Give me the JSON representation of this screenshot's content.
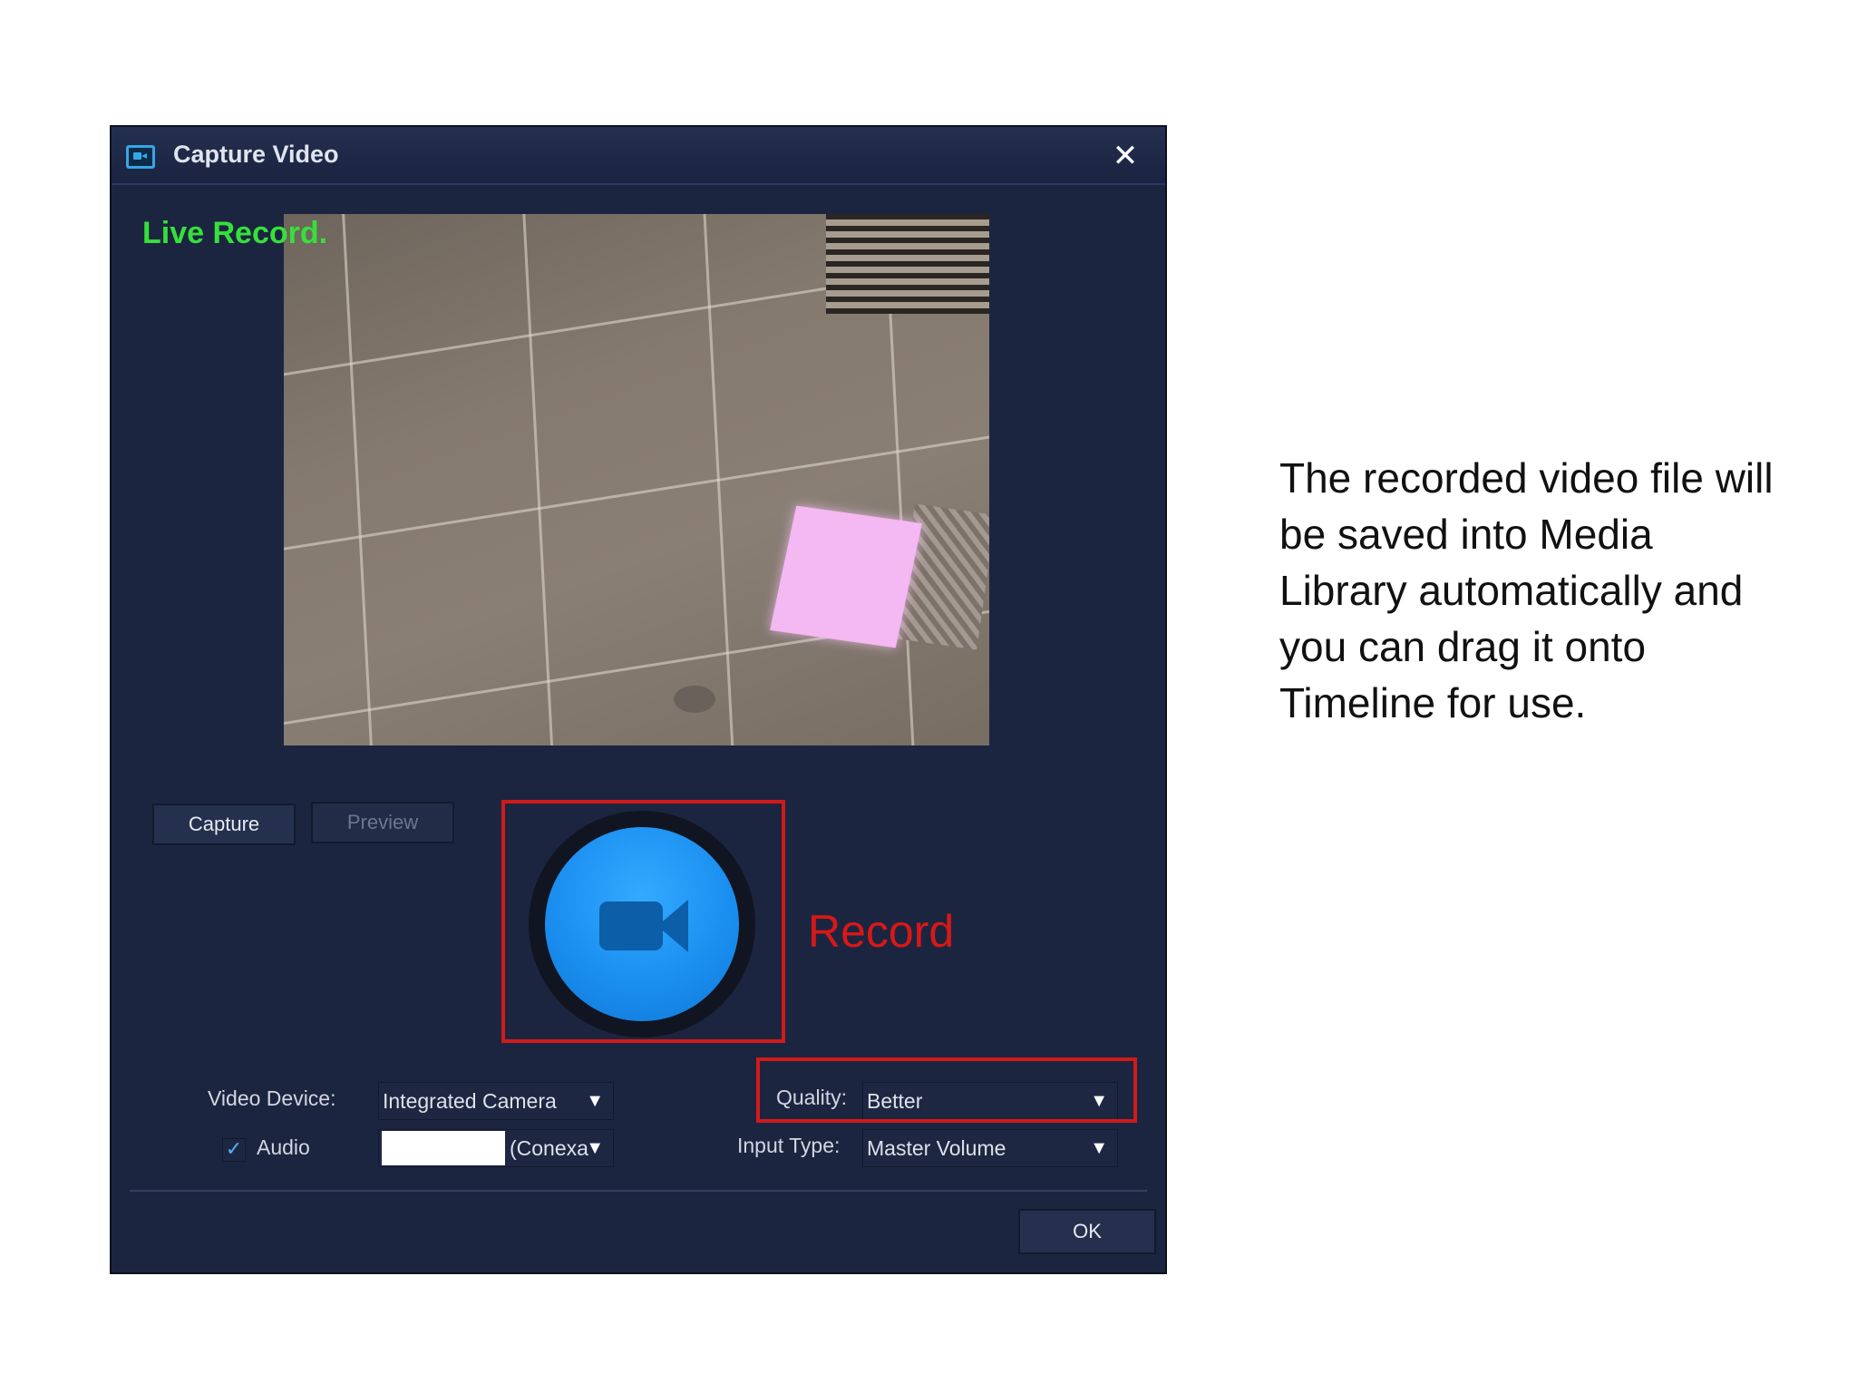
{
  "dialog": {
    "title": "Capture Video",
    "close_symbol": "✕",
    "live_label": "Live Record.",
    "buttons": {
      "capture": "Capture",
      "preview": "Preview",
      "ok": "OK"
    },
    "record_callout": "Record",
    "video_device": {
      "label": "Video Device:",
      "value": "Integrated Camera"
    },
    "quality": {
      "label": "Quality:",
      "value": "Better"
    },
    "audio": {
      "label": "Audio",
      "checked": true,
      "check_symbol": "✓",
      "device_value": "(Conexa"
    },
    "input_type": {
      "label": "Input Type:",
      "value": "Master Volume"
    },
    "dropdown_arrow": "▼"
  },
  "caption": {
    "text": "The recorded video file will be saved into Media Library automatically and you can drag it onto Timeline for use."
  },
  "colors": {
    "window_bg": "#1c2540",
    "live_label": "#35e03a",
    "highlight": "#d11a1a",
    "record_button": "#1b8ff0"
  },
  "icons": [
    "video-camera-icon",
    "close-icon",
    "record-camera-icon",
    "checkmark-icon",
    "dropdown-arrow-icon"
  ]
}
